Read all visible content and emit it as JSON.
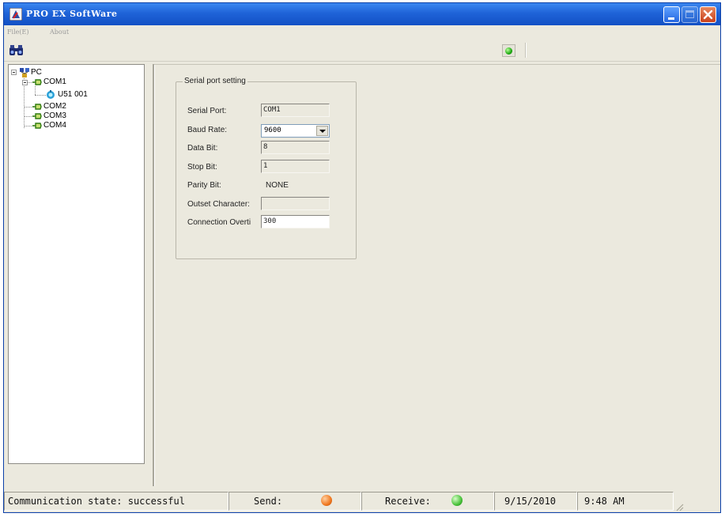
{
  "window": {
    "title": "PRO EX SoftWare",
    "controls": [
      "minimize",
      "maximize",
      "close"
    ]
  },
  "menu": {
    "items": [
      "File(E)",
      "About"
    ]
  },
  "toolbar": {
    "find_icon": "binoculars-icon",
    "status_led_color": "#1ca80f"
  },
  "tree": {
    "root": "PC",
    "ports": [
      {
        "label": "COM1",
        "expanded": true,
        "children": [
          "U51 001"
        ]
      },
      {
        "label": "COM2"
      },
      {
        "label": "COM3"
      },
      {
        "label": "COM4"
      }
    ]
  },
  "serial": {
    "group_title": "Serial port setting",
    "fields": {
      "port_label": "Serial Port:",
      "port_value": "COM1",
      "baud_label": "Baud Rate:",
      "baud_value": "9600",
      "data_label": "Data Bit:",
      "data_value": "8",
      "stop_label": "Stop Bit:",
      "stop_value": "1",
      "parity_label": "Parity Bit:",
      "parity_value": "NONE",
      "outset_label": "Outset Character:",
      "outset_value": "",
      "timeout_label": "Connection Overti",
      "timeout_value": "300"
    }
  },
  "statusbar": {
    "state": "Communication state: successful",
    "send_label": "Send:",
    "send_color": "#f07820",
    "receive_label": "Receive:",
    "receive_color": "#49c23b",
    "date": "9/15/2010",
    "time": "9:48 AM"
  }
}
